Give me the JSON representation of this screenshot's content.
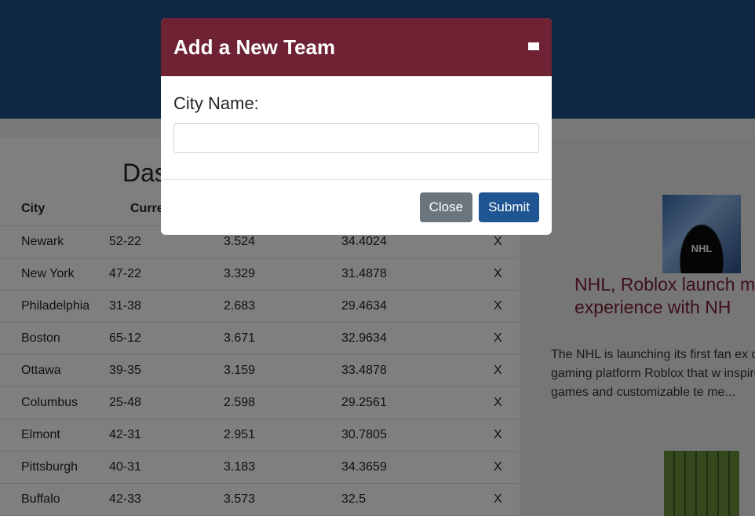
{
  "page": {
    "title_partial": "Das"
  },
  "table": {
    "headers": [
      "City",
      "Current Record",
      "",
      "",
      ""
    ],
    "rows": [
      {
        "city": "Newark",
        "record": "52-22",
        "v1": "3.524",
        "v2": "34.4024",
        "del": "X"
      },
      {
        "city": "New York",
        "record": "47-22",
        "v1": "3.329",
        "v2": "31.4878",
        "del": "X"
      },
      {
        "city": "Philadelphia",
        "record": "31-38",
        "v1": "2.683",
        "v2": "29.4634",
        "del": "X"
      },
      {
        "city": "Boston",
        "record": "65-12",
        "v1": "3.671",
        "v2": "32.9634",
        "del": "X"
      },
      {
        "city": "Ottawa",
        "record": "39-35",
        "v1": "3.159",
        "v2": "33.4878",
        "del": "X"
      },
      {
        "city": "Columbus",
        "record": "25-48",
        "v1": "2.598",
        "v2": "29.2561",
        "del": "X"
      },
      {
        "city": "Elmont",
        "record": "42-31",
        "v1": "2.951",
        "v2": "30.7805",
        "del": "X"
      },
      {
        "city": "Pittsburgh",
        "record": "40-31",
        "v1": "3.183",
        "v2": "34.3659",
        "del": "X"
      },
      {
        "city": "Buffalo",
        "record": "42-33",
        "v1": "3.573",
        "v2": "32.5",
        "del": "X"
      }
    ]
  },
  "news": {
    "logo_text": "NHL",
    "title": "NHL, Roblox launch m experience with NH",
    "text": "The NHL is launching its first fan ex online gaming platform Roblox that w inspired games and customizable te me..."
  },
  "modal": {
    "title": "Add a New Team",
    "field_label": "City Name:",
    "field_value": "",
    "field_placeholder": "",
    "close_label": "Close",
    "submit_label": "Submit"
  },
  "colors": {
    "header_blue": "#1d5189",
    "modal_header": "#6e2234",
    "close_btn": "#6c757d",
    "submit_btn": "#1f5592"
  }
}
